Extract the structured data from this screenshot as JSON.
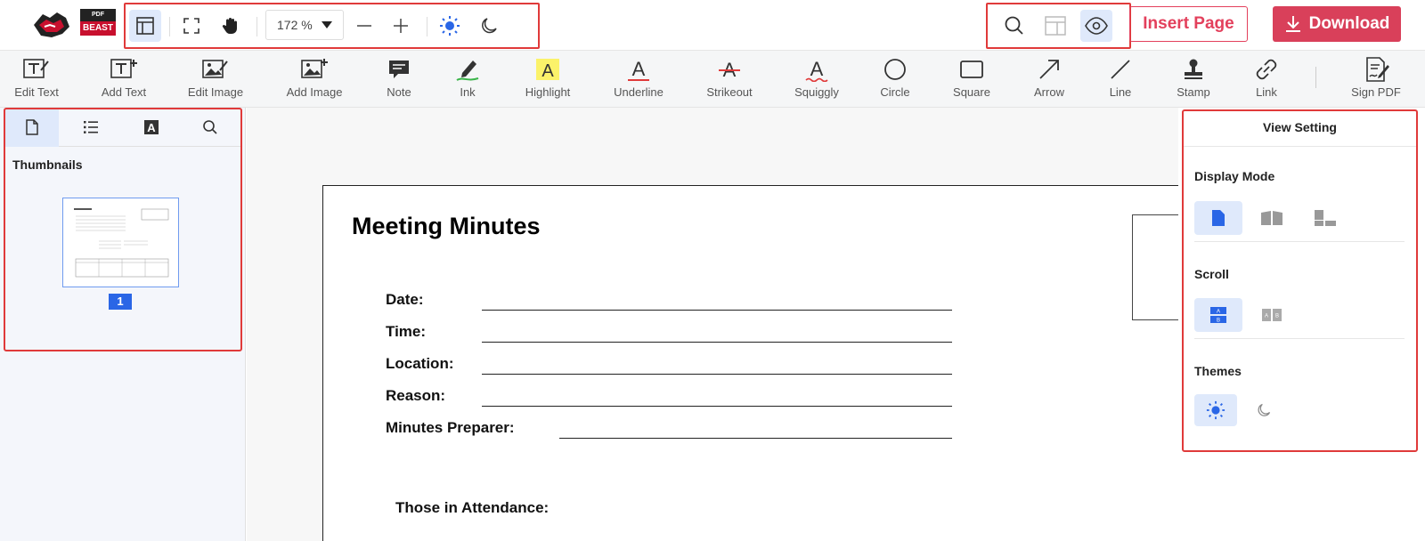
{
  "header": {
    "logo_text_top": "PDF",
    "logo_text_bottom": "BEAST",
    "zoom_value": "172 %",
    "insert_page_label": "Insert Page",
    "download_label": "Download"
  },
  "toolbar": {
    "items": [
      {
        "label": "Edit Text",
        "icon": "edit-text-icon"
      },
      {
        "label": "Add Text",
        "icon": "add-text-icon"
      },
      {
        "label": "Edit Image",
        "icon": "edit-image-icon"
      },
      {
        "label": "Add Image",
        "icon": "add-image-icon"
      },
      {
        "label": "Note",
        "icon": "note-icon"
      },
      {
        "label": "Ink",
        "icon": "ink-icon"
      },
      {
        "label": "Highlight",
        "icon": "highlight-icon"
      },
      {
        "label": "Underline",
        "icon": "underline-icon"
      },
      {
        "label": "Strikeout",
        "icon": "strikeout-icon"
      },
      {
        "label": "Squiggly",
        "icon": "squiggly-icon"
      },
      {
        "label": "Circle",
        "icon": "circle-icon"
      },
      {
        "label": "Square",
        "icon": "square-icon"
      },
      {
        "label": "Arrow",
        "icon": "arrow-icon"
      },
      {
        "label": "Line",
        "icon": "line-icon"
      },
      {
        "label": "Stamp",
        "icon": "stamp-icon"
      },
      {
        "label": "Link",
        "icon": "link-icon"
      },
      {
        "label": "Sign PDF",
        "icon": "sign-pdf-icon"
      }
    ]
  },
  "left_panel": {
    "section_title": "Thumbnails",
    "page_number": "1"
  },
  "document": {
    "title": "Meeting Minutes",
    "fields": [
      "Date:",
      "Time:",
      "Location:",
      "Reason:",
      "Minutes Preparer:"
    ],
    "attendance": "Those in Attendance:"
  },
  "right_panel": {
    "title": "View Setting",
    "display_mode": "Display Mode",
    "scroll": "Scroll",
    "themes": "Themes"
  },
  "colors": {
    "accent_blue": "#2a66e6",
    "brand_red": "#d9405a",
    "highlight_frame": "#e03a3a"
  }
}
